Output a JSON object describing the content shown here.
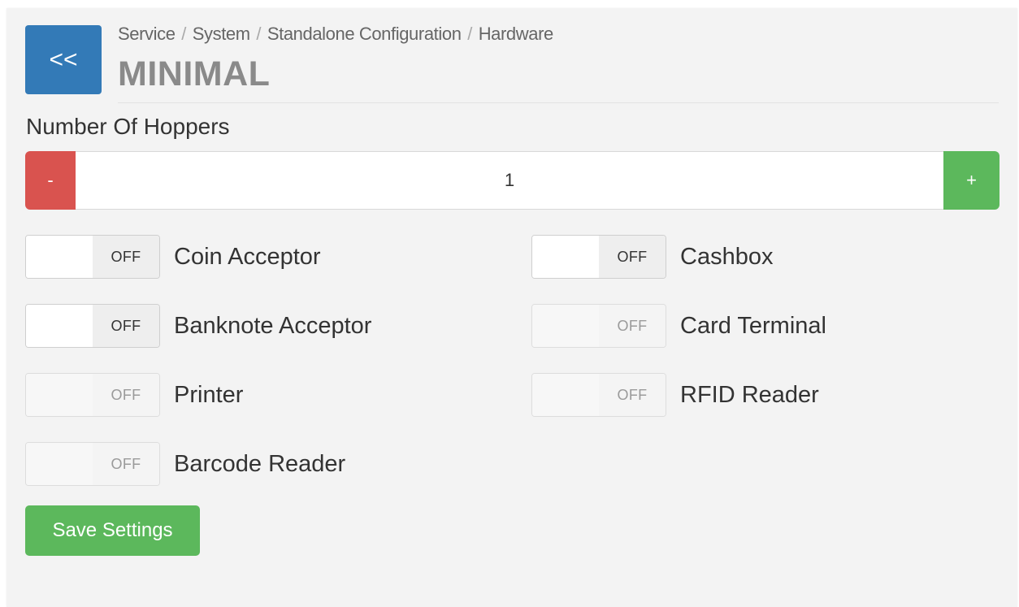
{
  "header": {
    "back_label": "<<",
    "breadcrumb": [
      "Service",
      "System",
      "Standalone Configuration",
      "Hardware"
    ],
    "separator": "/",
    "title": "MINIMAL"
  },
  "hoppers": {
    "label": "Number Of Hoppers",
    "minus_label": "-",
    "value": "1",
    "plus_label": "+"
  },
  "toggles": [
    {
      "label": "Coin Acceptor",
      "state": "OFF",
      "enabled": true
    },
    {
      "label": "Cashbox",
      "state": "OFF",
      "enabled": true
    },
    {
      "label": "Banknote Acceptor",
      "state": "OFF",
      "enabled": true
    },
    {
      "label": "Card Terminal",
      "state": "OFF",
      "enabled": false
    },
    {
      "label": "Printer",
      "state": "OFF",
      "enabled": false
    },
    {
      "label": "RFID Reader",
      "state": "OFF",
      "enabled": false
    },
    {
      "label": "Barcode Reader",
      "state": "OFF",
      "enabled": false
    }
  ],
  "save_label": "Save Settings",
  "colors": {
    "primary": "#337ab7",
    "danger": "#d9534f",
    "success": "#5cb85c",
    "panel_background": "#f3f3f3"
  }
}
